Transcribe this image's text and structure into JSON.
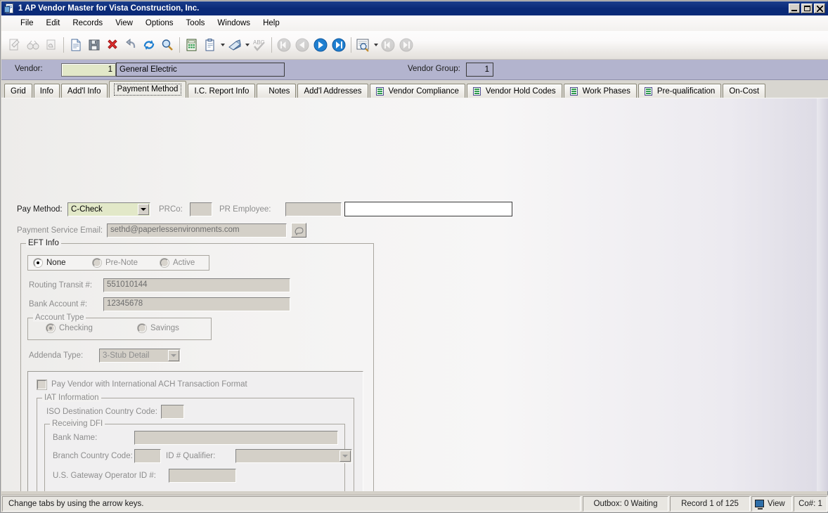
{
  "window": {
    "title": "1 AP Vendor Master for Vista Construction, Inc.",
    "icon": "document-window-icon",
    "minimize_label": "minimize-icon",
    "maximize_label": "maximize-icon",
    "close_label": "close-icon",
    "titlebar_color": "#0a2a78"
  },
  "menu": {
    "items": [
      {
        "label": "File"
      },
      {
        "label": "Edit"
      },
      {
        "label": "Records"
      },
      {
        "label": "View"
      },
      {
        "label": "Options"
      },
      {
        "label": "Tools"
      },
      {
        "label": "Windows"
      },
      {
        "label": "Help"
      }
    ]
  },
  "toolbar": {
    "buttons": [
      {
        "name": "form-entry-icon",
        "enabled": false
      },
      {
        "name": "binoculars-icon",
        "enabled": false
      },
      {
        "name": "grab-hand-icon",
        "enabled": false
      },
      {
        "sep": true
      },
      {
        "name": "new-document-icon",
        "enabled": true
      },
      {
        "name": "save-icon",
        "enabled": true
      },
      {
        "name": "delete-icon",
        "enabled": true
      },
      {
        "name": "undo-icon",
        "enabled": true
      },
      {
        "name": "refresh-icon",
        "enabled": true
      },
      {
        "name": "search-icon",
        "enabled": true
      },
      {
        "sep": true
      },
      {
        "name": "calculator-icon",
        "enabled": true
      },
      {
        "name": "clipboard-icon",
        "enabled": true
      },
      {
        "caret": true
      },
      {
        "name": "printer-icon",
        "enabled": true
      },
      {
        "caret": true
      },
      {
        "name": "spellcheck-icon",
        "enabled": false
      },
      {
        "sep": true
      },
      {
        "name": "first-record-icon",
        "enabled": false
      },
      {
        "name": "previous-record-icon",
        "enabled": false
      },
      {
        "name": "next-record-icon",
        "enabled": true
      },
      {
        "name": "last-record-icon",
        "enabled": true
      },
      {
        "sep": true
      },
      {
        "name": "preview-icon",
        "enabled": true
      },
      {
        "caret": true
      },
      {
        "name": "first-page-icon",
        "enabled": false
      },
      {
        "name": "last-page-icon",
        "enabled": false
      }
    ]
  },
  "header": {
    "vendor_label": "Vendor:",
    "vendor_number": "1",
    "vendor_name": "General Electric",
    "vendor_group_label": "Vendor Group:",
    "vendor_group": "1"
  },
  "tabs": {
    "active": "Payment Method",
    "items": [
      {
        "label": "Grid",
        "icon": null
      },
      {
        "label": "Info",
        "icon": null
      },
      {
        "label": "Add'l Info",
        "icon": null
      },
      {
        "label": "Payment Method",
        "icon": null
      },
      {
        "label": "I.C. Report Info",
        "icon": null
      },
      {
        "label": "Notes",
        "icon": null
      },
      {
        "label": "Add'l Addresses",
        "icon": null
      },
      {
        "label": "Vendor Compliance",
        "icon": "grid-sheet-icon"
      },
      {
        "label": "Vendor Hold Codes",
        "icon": "grid-sheet-icon"
      },
      {
        "label": "Work Phases",
        "icon": "grid-sheet-icon"
      },
      {
        "label": "Pre-qualification",
        "icon": "grid-sheet-icon"
      },
      {
        "label": "On-Cost",
        "icon": null
      }
    ]
  },
  "form": {
    "pay_method_label": "Pay Method:",
    "pay_method_value": "C-Check",
    "prco_label": "PRCo:",
    "prco_value": "",
    "pr_employee_label": "PR Employee:",
    "pr_employee_value": "",
    "pr_employee_desc": "",
    "payment_service_email_label": "Payment Service Email:",
    "payment_service_email_value": "sethd@paperlessenvironments.com",
    "email_button_icon": "email-lookup-icon",
    "eft": {
      "caption": "EFT Info",
      "status_options": [
        {
          "label": "None",
          "selected": true,
          "enabled": true
        },
        {
          "label": "Pre-Note",
          "selected": false,
          "enabled": false
        },
        {
          "label": "Active",
          "selected": false,
          "enabled": false
        }
      ],
      "routing_transit_label": "Routing Transit #:",
      "routing_transit_value": "551010144",
      "bank_account_label": "Bank Account #:",
      "bank_account_value": "12345678",
      "account_type": {
        "caption": "Account Type",
        "options": [
          {
            "label": "Checking",
            "selected": true,
            "enabled": false
          },
          {
            "label": "Savings",
            "selected": false,
            "enabled": false
          }
        ]
      },
      "addenda_type_label": "Addenda Type:",
      "addenda_type_value": "3-Stub Detail"
    },
    "iat": {
      "checkbox_label": "Pay Vendor with International ACH Transaction Format",
      "checkbox_checked": false,
      "caption": "IAT Information",
      "iso_country_label": "ISO Destination Country Code:",
      "iso_country_value": "",
      "receiving_dfi": {
        "caption": "Receiving DFI",
        "bank_name_label": "Bank Name:",
        "bank_name_value": "",
        "branch_country_label": "Branch Country Code:",
        "branch_country_value": "",
        "id_qualifier_label": "ID # Qualifier:",
        "id_qualifier_value": "",
        "gateway_operator_label": "U.S. Gateway Operator ID #:",
        "gateway_operator_value": ""
      }
    }
  },
  "statusbar": {
    "message": "Change tabs by using the arrow keys.",
    "outbox": "Outbox: 0 Waiting",
    "record": "Record 1 of 125",
    "view_icon": "monitor-icon",
    "view": "View",
    "company": "Co#: 1"
  }
}
